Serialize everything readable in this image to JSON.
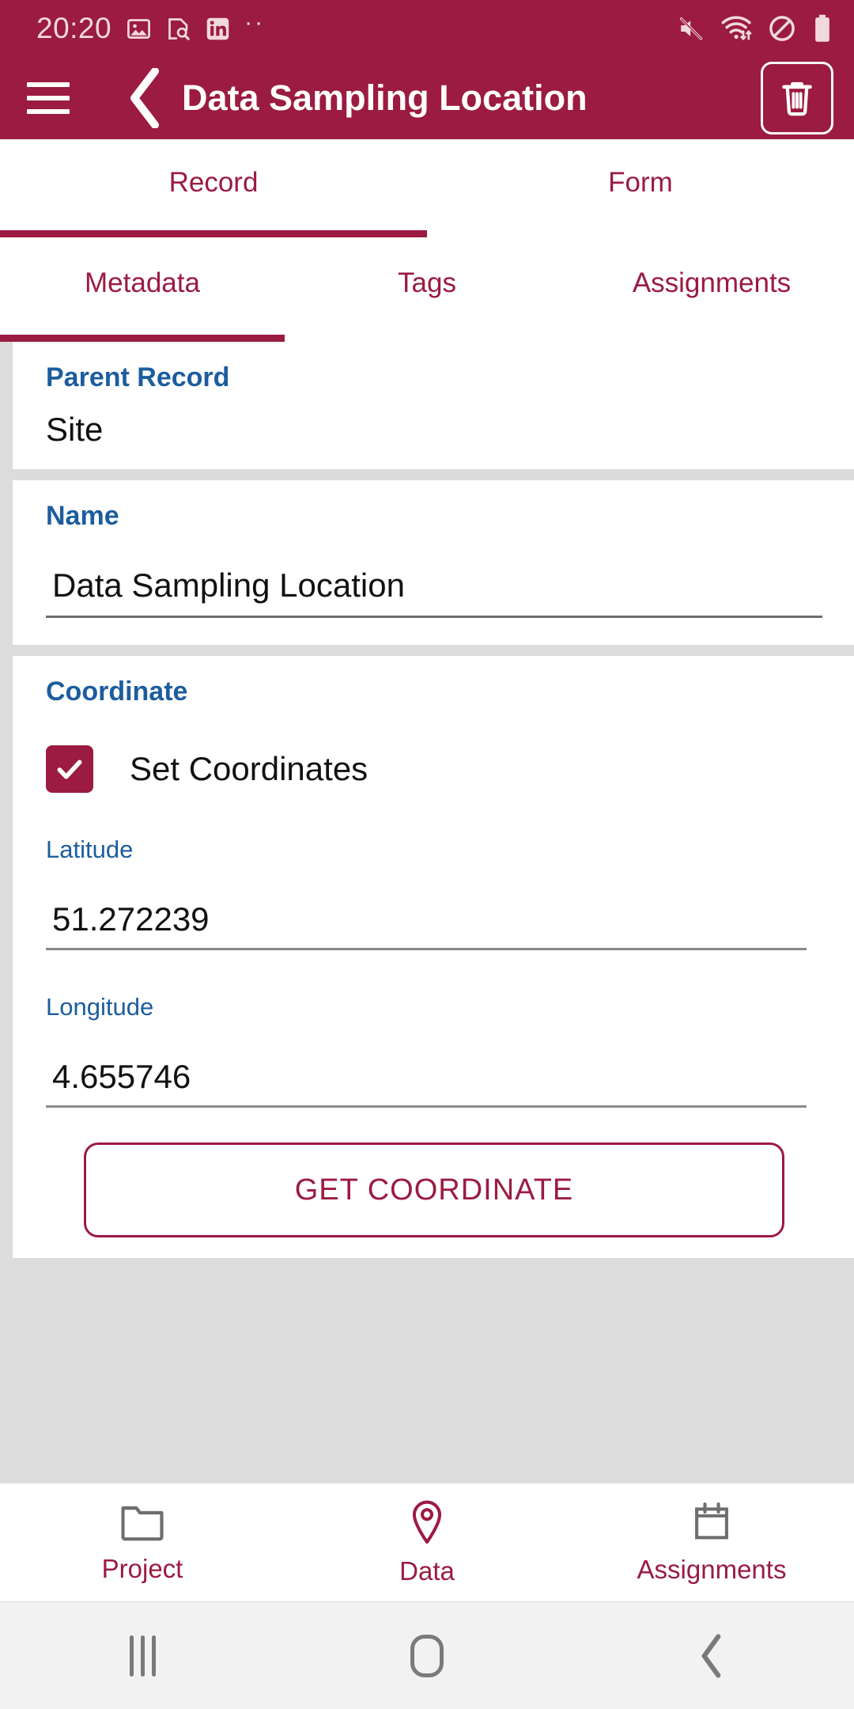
{
  "status_bar": {
    "time": "20:20",
    "left_icons": [
      "gallery-icon",
      "document-search-icon",
      "linkedin-icon",
      "overflow-dots-icon"
    ],
    "right_icons": [
      "mute-icon",
      "wifi-icon",
      "do-not-disturb-icon",
      "battery-icon"
    ]
  },
  "app_bar": {
    "menu_icon": "hamburger-menu-icon",
    "back_icon": "back-chevron-icon",
    "title": "Data Sampling Location",
    "delete_icon": "trash-icon"
  },
  "primary_tabs": {
    "items": [
      {
        "label": "Record",
        "active": true
      },
      {
        "label": "Form",
        "active": false
      }
    ]
  },
  "secondary_tabs": {
    "items": [
      {
        "label": "Metadata",
        "active": true
      },
      {
        "label": "Tags",
        "active": false
      },
      {
        "label": "Assignments",
        "active": false
      }
    ]
  },
  "form": {
    "parent_record": {
      "label": "Parent Record",
      "value": "Site"
    },
    "name": {
      "label": "Name",
      "value": "Data Sampling Location"
    },
    "coordinate": {
      "label": "Coordinate",
      "set_coordinates_label": "Set Coordinates",
      "set_coordinates_checked": true,
      "latitude_label": "Latitude",
      "latitude_value": "51.272239",
      "longitude_label": "Longitude",
      "longitude_value": "4.655746",
      "get_coordinate_button": "GET COORDINATE"
    }
  },
  "bottom_nav": {
    "items": [
      {
        "label": "Project",
        "icon": "folder-icon"
      },
      {
        "label": "Data",
        "icon": "map-pin-icon"
      },
      {
        "label": "Assignments",
        "icon": "calendar-icon"
      }
    ]
  },
  "system_nav": {
    "recents_icon": "recents-icon",
    "home_icon": "home-icon",
    "back_icon": "system-back-icon"
  },
  "colors": {
    "brand": "#9b1b42",
    "label_blue": "#1c5d9e",
    "page_background": "#dcdcdc"
  }
}
